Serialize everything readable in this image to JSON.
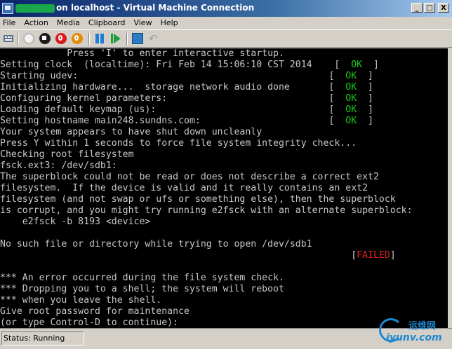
{
  "window": {
    "title_suffix": "on localhost - Virtual Machine Connection",
    "controls": {
      "minimize": "_",
      "maximize": "□",
      "close": "X"
    }
  },
  "menu": [
    "File",
    "Action",
    "Media",
    "Clipboard",
    "View",
    "Help"
  ],
  "toolbar": {
    "icons": [
      "ctrl-alt-del-icon",
      "start-icon",
      "turn-off-icon",
      "shut-down-icon",
      "save-icon",
      "pause-icon",
      "reset-icon",
      "snapshot-icon",
      "revert-icon"
    ],
    "colors": {
      "ok": "#18c818",
      "failed": "#e02020",
      "console_bg": "#000000"
    }
  },
  "console": {
    "lines": [
      {
        "text": "            Press 'I' to enter interactive startup."
      },
      {
        "text": "Setting clock  (localtime): Fri Feb 14 15:06:10 CST 2014",
        "pad": "    ",
        "status": "OK"
      },
      {
        "text": "Starting udev:",
        "pad": "                                             ",
        "status": "OK"
      },
      {
        "text": "Initializing hardware...  storage network audio done",
        "pad": "       ",
        "status": "OK"
      },
      {
        "text": "Configuring kernel parameters:",
        "pad": "                             ",
        "status": "OK"
      },
      {
        "text": "Loading default keymap (us):",
        "pad": "                               ",
        "status": "OK"
      },
      {
        "text": "Setting hostname main248.sundns.com:",
        "pad": "                       ",
        "status": "OK"
      },
      {
        "text": "Your system appears to have shut down uncleanly"
      },
      {
        "text": "Press Y within 1 seconds to force file system integrity check..."
      },
      {
        "text": "Checking root filesystem"
      },
      {
        "text": "fsck.ext3: /dev/sdb1:"
      },
      {
        "text": "The superblock could not be read or does not describe a correct ext2"
      },
      {
        "text": "filesystem.  If the device is valid and it really contains an ext2"
      },
      {
        "text": "filesystem (and not swap or ufs or something else), then the superblock"
      },
      {
        "text": "is corrupt, and you might try running e2fsck with an alternate superblock:"
      },
      {
        "text": "    e2fsck -b 8193 <device>"
      },
      {
        "text": ""
      },
      {
        "text": "No such file or directory while trying to open /dev/sdb1"
      },
      {
        "text": "",
        "pad": "                                                               ",
        "failed": "FAILED"
      },
      {
        "text": ""
      },
      {
        "text": "*** An error occurred during the file system check."
      },
      {
        "text": "*** Dropping you to a shell; the system will reboot"
      },
      {
        "text": "*** when you leave the shell."
      },
      {
        "text": "Give root password for maintenance"
      },
      {
        "text": "(or type Control-D to continue):"
      }
    ]
  },
  "status": {
    "label": "Status:",
    "value": "Running"
  },
  "watermark": {
    "cn": "运维网",
    "en": "iyunv.com"
  }
}
